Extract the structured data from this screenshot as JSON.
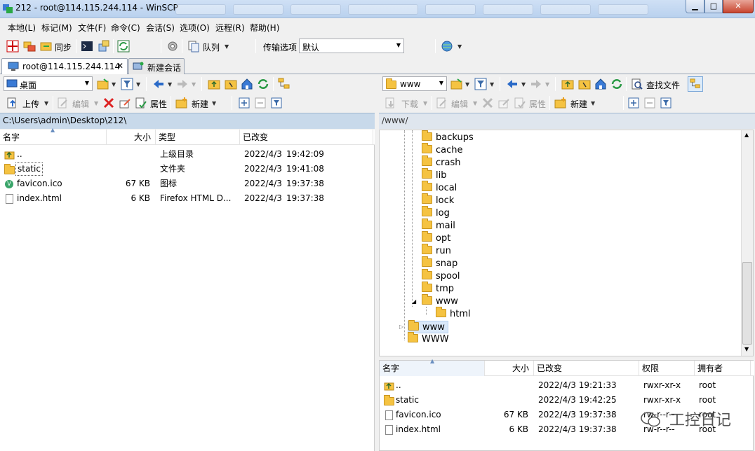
{
  "window": {
    "title": "212 - root@114.115.244.114 - WinSCP"
  },
  "menu": [
    "本地(L)",
    "标记(M)",
    "文件(F)",
    "命令(C)",
    "会话(S)",
    "选项(O)",
    "远程(R)",
    "帮助(H)"
  ],
  "toolbar": {
    "sync_label": "同步",
    "queue_label": "队列",
    "transfer_label": "传输选项",
    "transfer_value": "默认"
  },
  "tabs": [
    {
      "label": "root@114.115.244.114"
    },
    {
      "label": "新建会话"
    }
  ],
  "local": {
    "location": "桌面",
    "path": "C:\\Users\\admin\\Desktop\\212\\",
    "upload": "上传",
    "edit": "编辑",
    "props": "属性",
    "new": "新建",
    "columns": [
      "名字",
      "大小",
      "类型",
      "已改变"
    ],
    "files": [
      {
        "name": "..",
        "size": "",
        "type": "上级目录",
        "date": "2022/4/3",
        "time": "19:42:09"
      },
      {
        "name": "static",
        "size": "",
        "type": "文件夹",
        "date": "2022/4/3",
        "time": "19:41:08"
      },
      {
        "name": "favicon.ico",
        "size": "67 KB",
        "type": "图标",
        "date": "2022/4/3",
        "time": "19:37:38"
      },
      {
        "name": "index.html",
        "size": "6 KB",
        "type": "Firefox HTML D...",
        "date": "2022/4/3",
        "time": "19:37:38"
      }
    ]
  },
  "remote": {
    "location": "www",
    "find": "查找文件",
    "path": "/www/",
    "download": "下载",
    "edit": "编辑",
    "props": "属性",
    "new": "新建",
    "tree": [
      "backups",
      "cache",
      "crash",
      "lib",
      "local",
      "lock",
      "log",
      "mail",
      "opt",
      "run",
      "snap",
      "spool",
      "tmp",
      "www",
      "html",
      "www",
      "WWW"
    ],
    "columns": [
      "名字",
      "大小",
      "已改变",
      "权限",
      "拥有者"
    ],
    "files": [
      {
        "name": "..",
        "size": "",
        "date": "2022/4/3 19:21:33",
        "perm": "rwxr-xr-x",
        "owner": "root"
      },
      {
        "name": "static",
        "size": "",
        "date": "2022/4/3 19:42:25",
        "perm": "rwxr-xr-x",
        "owner": "root"
      },
      {
        "name": "favicon.ico",
        "size": "67 KB",
        "date": "2022/4/3 19:37:38",
        "perm": "rw-r--r--",
        "owner": "root"
      },
      {
        "name": "index.html",
        "size": "6 KB",
        "date": "2022/4/3 19:37:38",
        "perm": "rw-r--r--",
        "owner": "root"
      }
    ]
  },
  "watermark": "工控日记"
}
